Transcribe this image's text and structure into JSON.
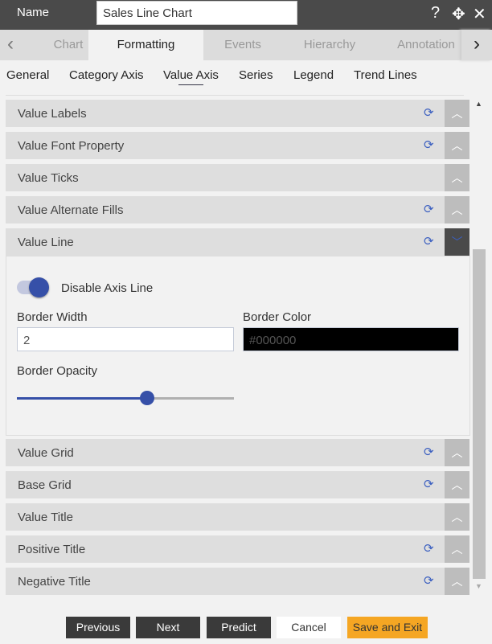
{
  "header": {
    "name_label": "Name",
    "name_value": "Sales Line Chart"
  },
  "tabs": [
    {
      "label": "Chart"
    },
    {
      "label": "Formatting"
    },
    {
      "label": "Events"
    },
    {
      "label": "Hierarchy"
    },
    {
      "label": "Annotation"
    }
  ],
  "subtabs": [
    {
      "label": "General"
    },
    {
      "label": "Category Axis"
    },
    {
      "label": "Value Axis"
    },
    {
      "label": "Series"
    },
    {
      "label": "Legend"
    },
    {
      "label": "Trend Lines"
    }
  ],
  "sections": [
    {
      "label": "Value Labels"
    },
    {
      "label": "Value Font Property"
    },
    {
      "label": "Value Ticks"
    },
    {
      "label": "Value Alternate Fills"
    },
    {
      "label": "Value Line"
    },
    {
      "label": "Value Grid"
    },
    {
      "label": "Base Grid"
    },
    {
      "label": "Value Title"
    },
    {
      "label": "Positive Title"
    },
    {
      "label": "Negative Title"
    }
  ],
  "value_line": {
    "toggle_label": "Disable Axis Line",
    "toggle_on": true,
    "border_width_label": "Border Width",
    "border_width": "2",
    "border_color_label": "Border Color",
    "border_color": "#000000",
    "border_opacity_label": "Border Opacity",
    "border_opacity": 0.6
  },
  "footer": {
    "previous": "Previous",
    "next": "Next",
    "predict": "Predict",
    "cancel": "Cancel",
    "save_exit": "Save and Exit"
  },
  "colors": {
    "accent": "#3650a8",
    "save": "#f5a623",
    "header": "#4a4a4a"
  }
}
